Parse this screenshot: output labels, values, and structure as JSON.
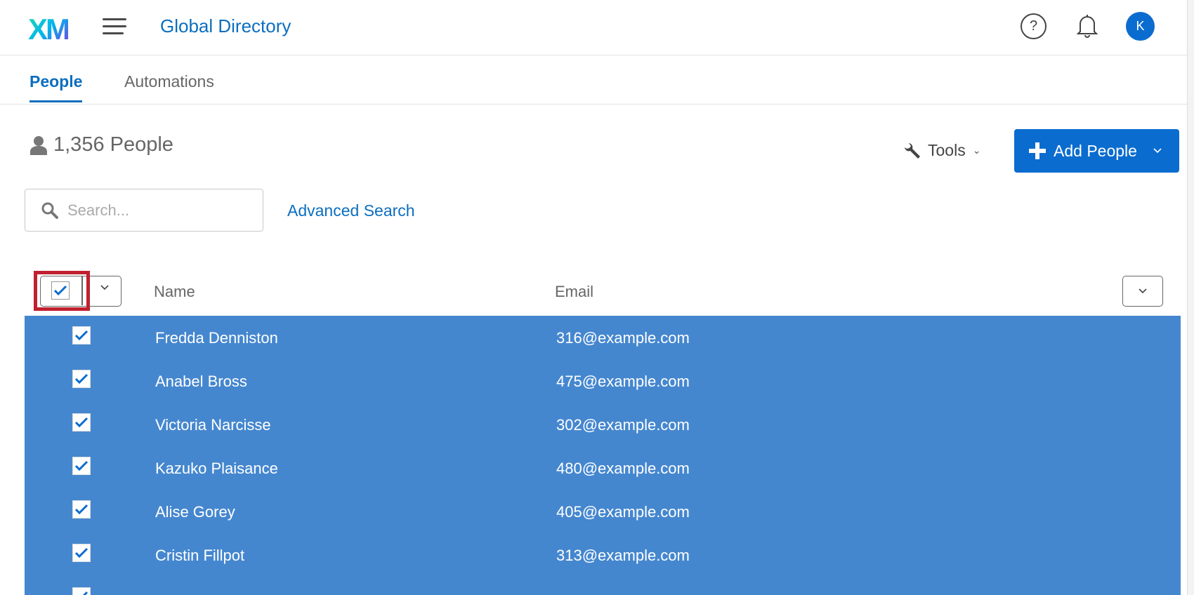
{
  "header": {
    "logo": "XM",
    "title": "Global Directory",
    "avatar_initial": "K"
  },
  "tabs": [
    {
      "label": "People",
      "active": true
    },
    {
      "label": "Automations",
      "active": false
    }
  ],
  "summary": {
    "count_text": "1,356 People"
  },
  "toolbar": {
    "tools_label": "Tools",
    "add_label": "Add People"
  },
  "search": {
    "placeholder": "Search...",
    "value": "",
    "advanced_label": "Advanced Search"
  },
  "table": {
    "columns": [
      "Name",
      "Email"
    ],
    "select_all_checked": true,
    "rows": [
      {
        "name": "Fredda Denniston",
        "email": "316@example.com",
        "checked": true
      },
      {
        "name": "Anabel Bross",
        "email": "475@example.com",
        "checked": true
      },
      {
        "name": "Victoria Narcisse",
        "email": "302@example.com",
        "checked": true
      },
      {
        "name": "Kazuko Plaisance",
        "email": "480@example.com",
        "checked": true
      },
      {
        "name": "Alise Gorey",
        "email": "405@example.com",
        "checked": true
      },
      {
        "name": "Cristin Fillpot",
        "email": "313@example.com",
        "checked": true
      }
    ]
  },
  "colors": {
    "accent": "#0b6ccf",
    "selected_row": "#4587cf",
    "highlight": "#c0202f"
  }
}
